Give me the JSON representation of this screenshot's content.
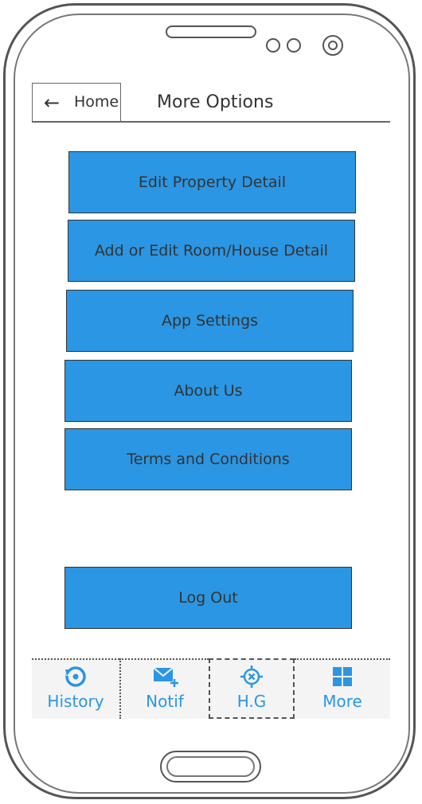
{
  "header": {
    "back_icon": "arrow-left-icon",
    "back_label": "Home",
    "title": "More Options"
  },
  "options": [
    {
      "label": "Edit Property Detail"
    },
    {
      "label": "Add or Edit Room/House Detail"
    },
    {
      "label": "App Settings"
    },
    {
      "label": "About Us"
    },
    {
      "label": "Terms and Conditions"
    }
  ],
  "logout": {
    "label": "Log Out"
  },
  "tabbar": {
    "tabs": [
      {
        "label": "History",
        "icon": "history-icon"
      },
      {
        "label": "Notif",
        "icon": "mail-plus-icon"
      },
      {
        "label": "H.G",
        "icon": "crosshair-icon"
      },
      {
        "label": "More",
        "icon": "grid-icon"
      }
    ]
  },
  "colors": {
    "accent": "#2b96e3",
    "button_text": "#333333",
    "tabbar_bg": "#f4f4f4"
  }
}
